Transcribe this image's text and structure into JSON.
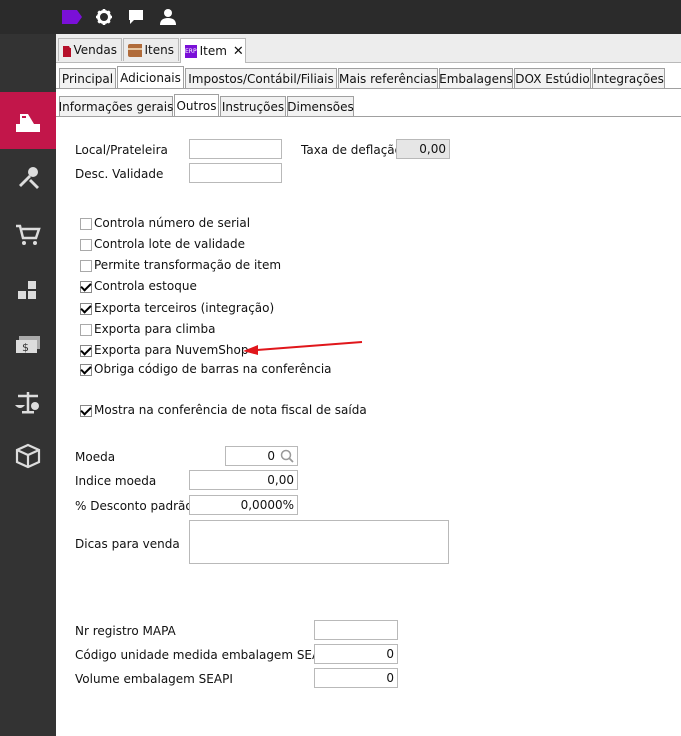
{
  "topbar": {
    "icons": [
      "tag-icon",
      "gear-icon",
      "chat-icon",
      "user-icon"
    ]
  },
  "sidebar": {
    "items": [
      "register-icon",
      "tools-icon",
      "cart-icon",
      "stock-icon",
      "money-icon",
      "scale-icon",
      "box-icon"
    ],
    "active": 0
  },
  "doc_tabs": [
    {
      "label": "Vendas",
      "icon": "folder-icon"
    },
    {
      "label": "Itens",
      "icon": "box-icon"
    },
    {
      "label": "Item",
      "icon": "erp-icon",
      "badge": "ERP",
      "closable": true
    }
  ],
  "main_tabs": [
    "Principal",
    "Adicionais",
    "Impostos/Contábil/Filiais",
    "Mais referências",
    "Embalagens",
    "DOX Estúdio",
    "Integrações"
  ],
  "sub_tabs": [
    "Informações gerais",
    "Outros",
    "Instruções",
    "Dimensões"
  ],
  "form": {
    "local_label": "Local/Prateleira",
    "local_value": "",
    "taxa_label": "Taxa de deflação",
    "taxa_value": "0,00",
    "validade_label": "Desc. Validade",
    "validade_value": ""
  },
  "checkboxes": [
    {
      "label": "Controla número de serial",
      "checked": false
    },
    {
      "label": "Controla lote de validade",
      "checked": false
    },
    {
      "label": "Permite transformação de item",
      "checked": false
    },
    {
      "label": "Controla estoque",
      "checked": true
    },
    {
      "label": "Exporta terceiros (integração)",
      "checked": true
    },
    {
      "label": "Exporta para climba",
      "checked": false
    },
    {
      "label": "Exporta para NuvemShop",
      "checked": true
    },
    {
      "label": "Obriga código de barras na conferência",
      "checked": true
    },
    {
      "label": "Mostra na conferência de nota fiscal de saída",
      "checked": true
    }
  ],
  "pricing": {
    "moeda_label": "Moeda",
    "moeda_value": "0",
    "indice_label": "Indice moeda",
    "indice_value": "0,00",
    "desconto_label": "% Desconto padrão",
    "desconto_value": "0,0000%",
    "dicas_label": "Dicas para venda",
    "dicas_value": ""
  },
  "registry": {
    "mapa_label": "Nr registro MAPA",
    "mapa_value": "",
    "codigo_label": "Código unidade medida embalagem SEAPI",
    "codigo_value": "0",
    "volume_label": "Volume embalagem SEAPI",
    "volume_value": "0"
  },
  "colors": {
    "accent": "#c2164a",
    "arrow": "#e0161b",
    "topbar": "#2b2b2b",
    "sidebar": "#333333"
  }
}
